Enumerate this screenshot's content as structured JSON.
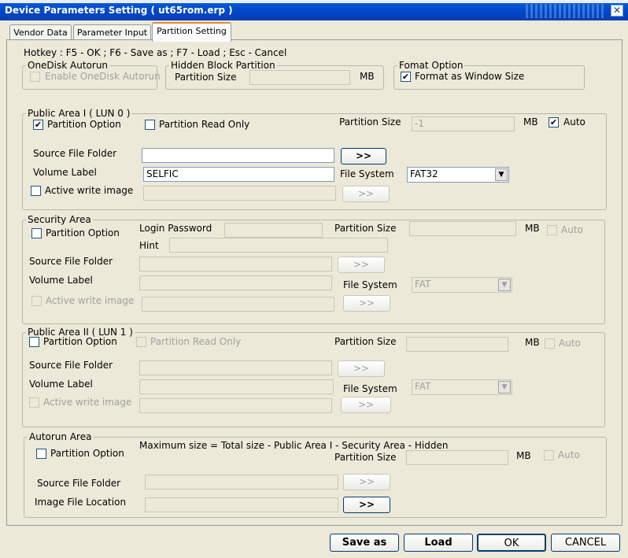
{
  "window": {
    "title": "Device Parameters Setting ( ut65rom.erp )",
    "close_icon": "x-icon"
  },
  "tabs": [
    "Vendor Data",
    "Parameter Input",
    "Partition Setting"
  ],
  "hotkey": "Hotkey : F5 - OK ; F6 - Save as ; F7 - Load ; Esc - Cancel",
  "onedisk": {
    "legend": "OneDisk Autorun",
    "enable": "Enable OneDisk Autorun"
  },
  "hidden": {
    "legend": "Hidden Block Partition",
    "size_label": "Partition Size",
    "unit": "MB"
  },
  "format": {
    "legend": "Fomat Option",
    "format_label": "Format as Window Size"
  },
  "public1": {
    "legend": "Public Area I ( LUN 0 )",
    "partition_option": "Partition Option",
    "read_only": "Partition Read Only",
    "size_label": "Partition Size",
    "size_value": "-1",
    "unit": "MB",
    "auto": "Auto",
    "source_folder": "Source File Folder",
    "source_value": "",
    "browse": ">>",
    "volume_label": "Volume Label",
    "volume_value": "SELFIC",
    "fs_label": "File System",
    "fs_value": "FAT32",
    "active_write": "Active write image",
    "browse2": ">>"
  },
  "security": {
    "legend": "Security Area",
    "partition_option": "Partition Option",
    "login": "Login Password",
    "size_label": "Partition Size",
    "unit": "MB",
    "auto": "Auto",
    "hint": "Hint",
    "source_folder": "Source File Folder",
    "browse": ">>",
    "volume_label": "Volume Label",
    "fs_label": "File System",
    "fs_value": "FAT",
    "active_write": "Active write image",
    "browse2": ">>"
  },
  "public2": {
    "legend": "Public Area II ( LUN 1 )",
    "partition_option": "Partition Option",
    "read_only": "Partition Read Only",
    "size_label": "Partition Size",
    "unit": "MB",
    "auto": "Auto",
    "source_folder": "Source File Folder",
    "browse": ">>",
    "volume_label": "Volume Label",
    "fs_label": "File System",
    "fs_value": "FAT",
    "active_write": "Active write image",
    "browse2": ">>"
  },
  "autorun": {
    "legend": "Autorun Area",
    "note": "Maximum size = Total size - Public Area I - Security Area - Hidden",
    "partition_option": "Partition Option",
    "size_label": "Partition Size",
    "unit": "MB",
    "auto": "Auto",
    "source_folder": "Source File Folder",
    "browse": ">>",
    "image_location": "Image File Location",
    "browse2": ">>"
  },
  "buttons": {
    "save_as": "Save as",
    "load": "Load",
    "ok": "OK",
    "cancel": "CANCEL"
  }
}
